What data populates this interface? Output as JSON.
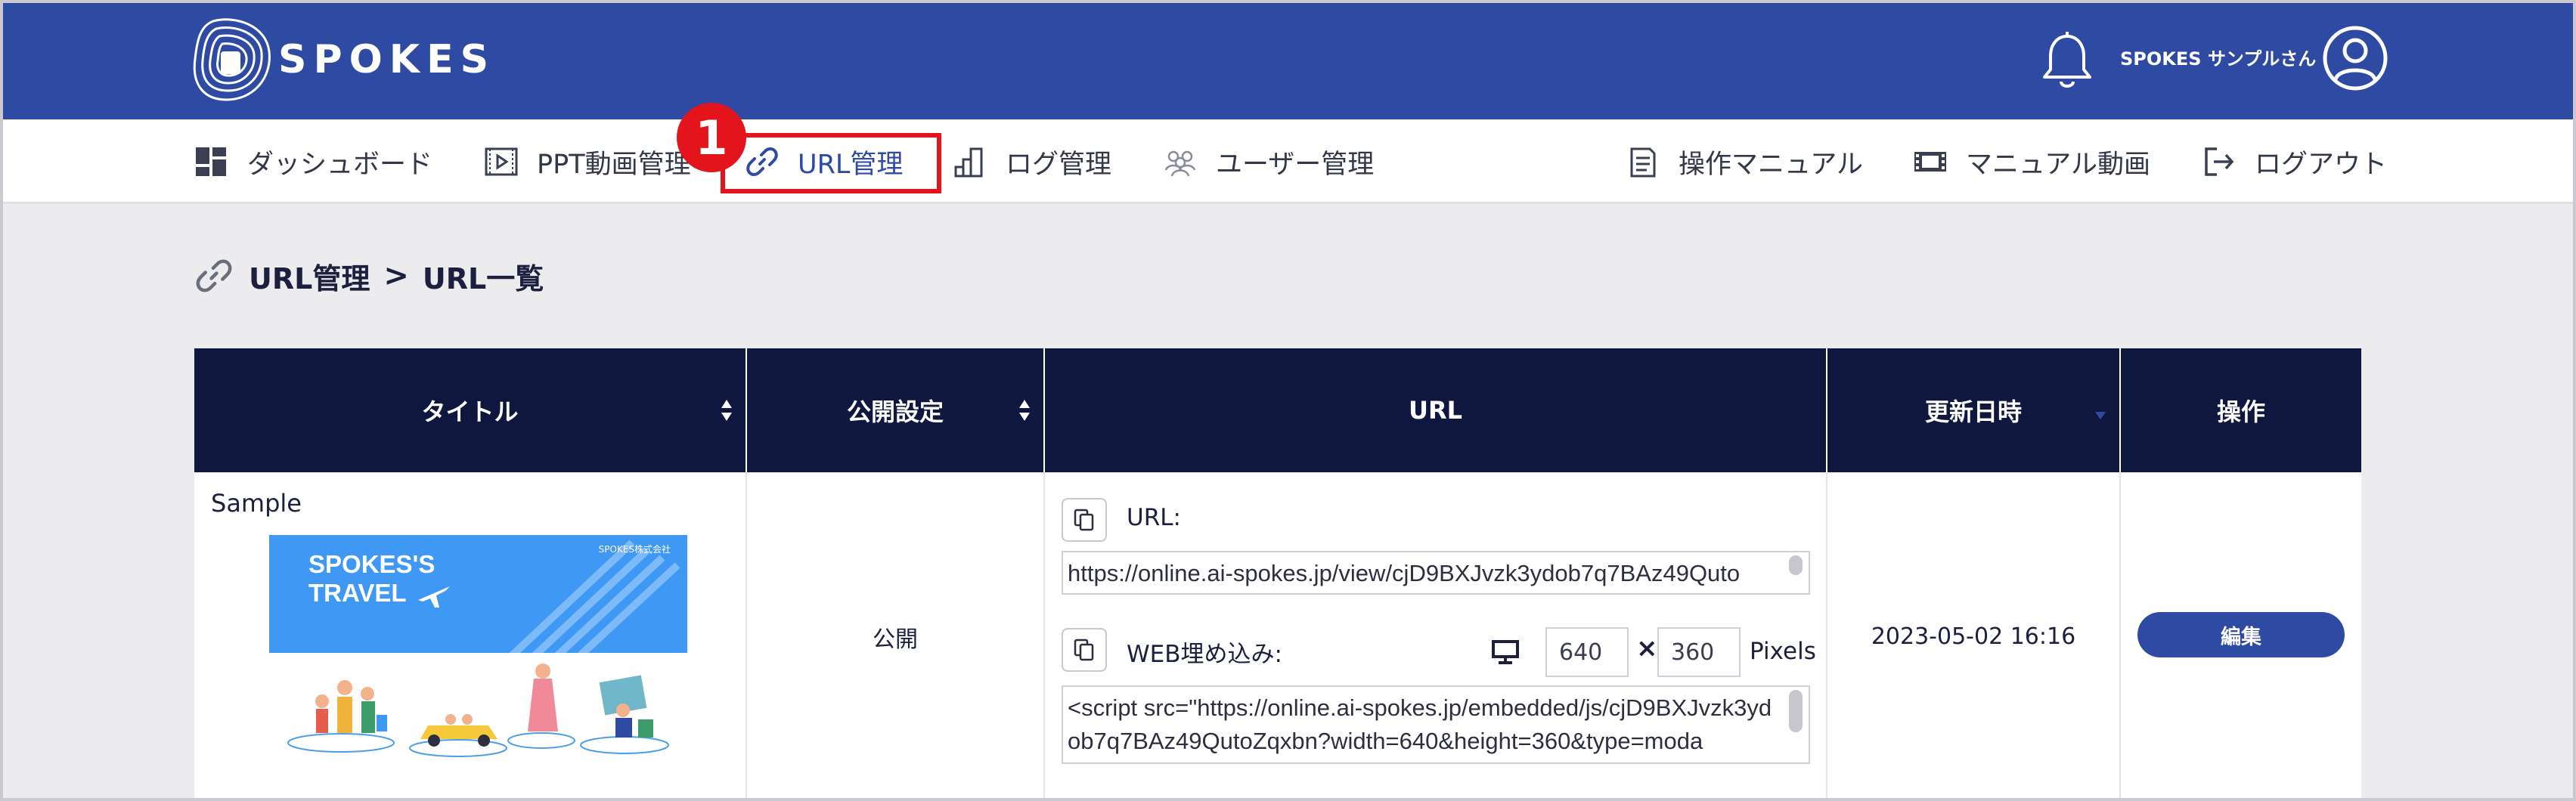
{
  "header": {
    "logo_text": "SPOKES",
    "user_name": "SPOKES サンプルさん",
    "icons": [
      "logo-icon",
      "bell-icon",
      "user-avatar-icon"
    ]
  },
  "nav": {
    "items": [
      {
        "label": "ダッシュボード",
        "icon": "dashboard-icon"
      },
      {
        "label": "PPT動画管理",
        "icon": "ppt-video-icon"
      },
      {
        "label": "URL管理",
        "icon": "link-icon",
        "active": true
      },
      {
        "label": "ログ管理",
        "icon": "log-chart-icon"
      },
      {
        "label": "ユーザー管理",
        "icon": "users-icon"
      },
      {
        "label": "操作マニュアル",
        "icon": "manual-icon"
      },
      {
        "label": "マニュアル動画",
        "icon": "film-icon"
      },
      {
        "label": "ログアウト",
        "icon": "logout-icon"
      }
    ]
  },
  "annotation": {
    "step_number": "1",
    "color": "#e3141b"
  },
  "breadcrumb": {
    "parent": "URL管理",
    "separator": ">",
    "current": "URL一覧"
  },
  "table": {
    "columns": [
      {
        "label": "タイトル",
        "sortable": true
      },
      {
        "label": "公開設定",
        "sortable": true
      },
      {
        "label": "URL",
        "sortable": false
      },
      {
        "label": "更新日時",
        "sortable": true,
        "sorted": "desc"
      },
      {
        "label": "操作",
        "sortable": false
      }
    ],
    "rows": [
      {
        "title": "Sample",
        "thumbnail": {
          "title": "SPOKES'S\nTRAVEL",
          "company": "SPOKES株式会社"
        },
        "visibility": "公開",
        "url_label": "URL:",
        "url_value": "https://online.ai-spokes.jp/view/cjD9BXJvzk3ydob7q7BAz49Quto",
        "embed_label": "WEB埋め込み:",
        "embed_width": "640",
        "embed_times": "×",
        "embed_height": "360",
        "embed_unit": "Pixels",
        "embed_code": "<script src=\"https://online.ai-spokes.jp/embedded/js/cjD9BXJvzk3ydob7q7BAz49QutoZqxbn?width=640&height=360&type=moda",
        "updated_at": "2023-05-02 16:16",
        "action_label": "編集"
      }
    ]
  },
  "colors": {
    "header_bg": "#2f4aa3",
    "table_header_bg": "#10173f",
    "accent": "#2f4aa3",
    "page_bg": "#ececee"
  }
}
